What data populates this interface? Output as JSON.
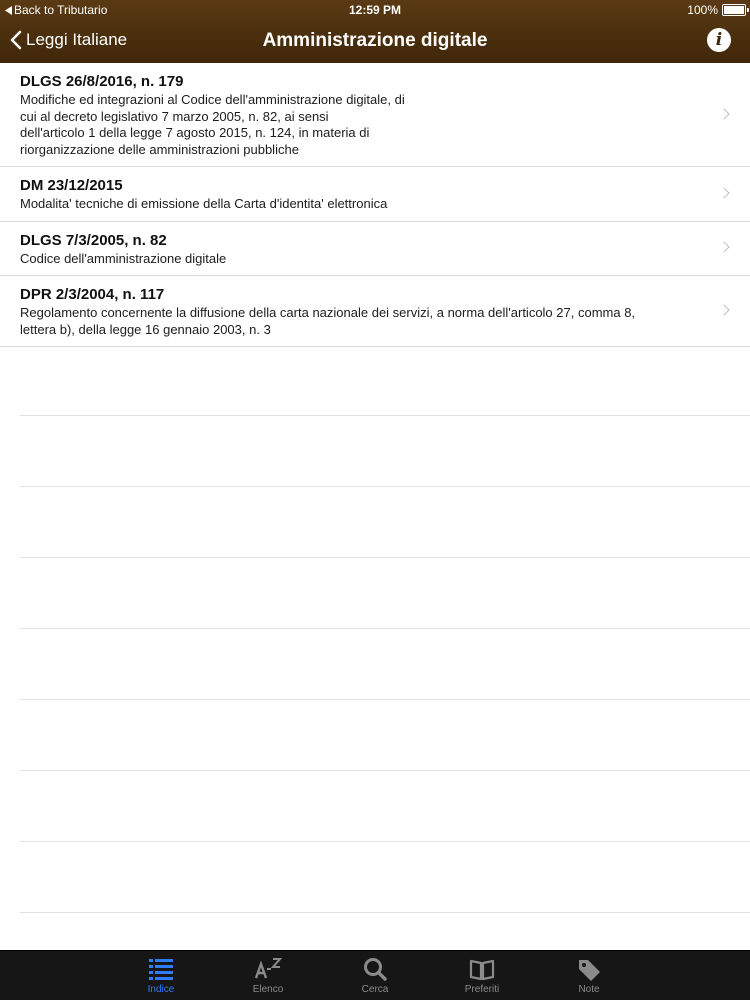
{
  "status": {
    "back_label": "Back to Tributario",
    "time": "12:59 PM",
    "battery": "100%"
  },
  "nav": {
    "back_label": "Leggi Italiane",
    "title": "Amministrazione digitale",
    "info_label": "i"
  },
  "items": [
    {
      "title": "DLGS 26/8/2016, n. 179",
      "description": "Modifiche ed integrazioni al Codice dell'amministrazione digitale, di\ncui  al decreto legislativo 7 marzo 2005, n.  82, ai sensi\ndell'articolo 1 della legge 7 agosto 2015,  n. 124,  in materia di\nriorganizzazione delle amministrazioni pubbliche"
    },
    {
      "title": "DM 23/12/2015",
      "description": "Modalita' tecniche di emissione della Carta d'identita' elettronica"
    },
    {
      "title": "DLGS 7/3/2005, n. 82",
      "description": "Codice dell'amministrazione digitale"
    },
    {
      "title": "DPR 2/3/2004, n. 117",
      "description": "Regolamento concernente la diffusione della carta nazionale dei servizi, a norma dell'articolo 27, comma 8,\nlettera b), della legge 16 gennaio 2003, n. 3"
    }
  ],
  "tabs": [
    {
      "label": "Indice",
      "icon": "list-icon",
      "active": true
    },
    {
      "label": "Elenco",
      "icon": "az-icon",
      "active": false
    },
    {
      "label": "Cerca",
      "icon": "search-icon",
      "active": false
    },
    {
      "label": "Preferiti",
      "icon": "book-icon",
      "active": false
    },
    {
      "label": "Note",
      "icon": "tag-icon",
      "active": false
    }
  ],
  "colors": {
    "nav_bar": "#4a3010",
    "tab_active": "#2f7cf6",
    "tab_inactive": "#8b8b8b",
    "tab_bar": "#161616"
  }
}
